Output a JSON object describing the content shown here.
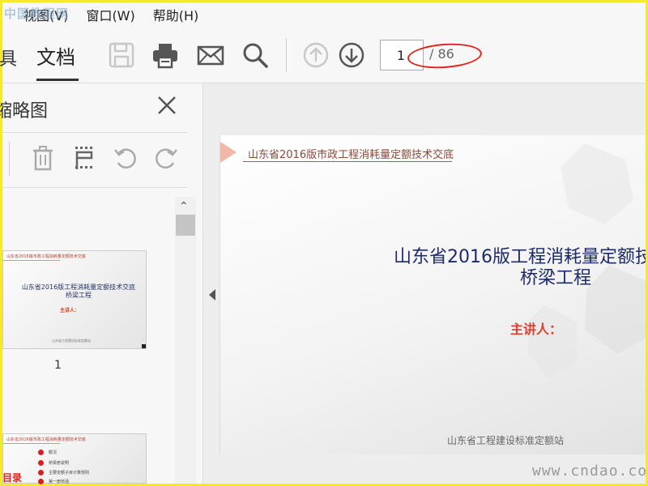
{
  "menu": {
    "items": [
      "视图(V)",
      "窗口(W)",
      "帮助(H)"
    ]
  },
  "watermarks": {
    "top_left": "中国教程网",
    "bottom_right": "www.cndao.com"
  },
  "toolbar": {
    "tab_partial": "具",
    "tab_document": "文档",
    "icons": [
      "save-icon",
      "print-icon",
      "mail-icon",
      "search-icon",
      "arrow-up-circle-icon",
      "arrow-down-circle-icon"
    ],
    "page_current": "1",
    "page_total": "/ 86"
  },
  "sidebar": {
    "title": "缩略图",
    "tools": [
      "delete-icon",
      "extract-pages-icon",
      "rotate-left-icon",
      "rotate-right-icon"
    ],
    "thumbnail1": {
      "head": "山东省2016版市政工程消耗量定额技术交底",
      "title_line1": "山东省2016版工程消耗量定额技术交底",
      "title_line2": "桥梁工程",
      "speaker": "主讲人：",
      "footer": "山东省工程建设标准定额站",
      "page_number": "1"
    },
    "thumbnail2": {
      "head": "山东省2016版市政工程消耗量定额技术交底",
      "label": "目录",
      "rows": [
        "概况",
        "桥梁册说明",
        "主要定额子目计算规则",
        "第一册桥涵"
      ]
    }
  },
  "document_page": {
    "header": "山东省2016版市政工程消耗量定额技术交底",
    "title_line1": "山东省2016版工程消耗量定额技",
    "title_line2": "桥梁工程",
    "speaker": "主讲人：",
    "footer": "山东省工程建设标准定额站"
  },
  "colors": {
    "annotation_ellipse": "#e0251b",
    "title_blue": "#1d2a6b",
    "speaker_red": "#e0402a",
    "screenshot_border": "#f5ea2a"
  }
}
